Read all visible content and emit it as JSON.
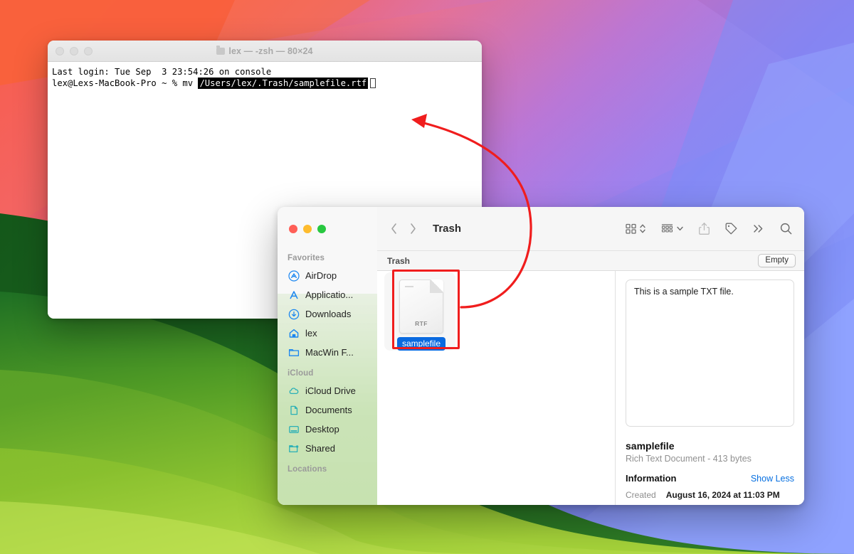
{
  "desktop": {
    "wallpaper_name": "macos-ventura-gradient",
    "colors": {
      "orange": "#f7603f",
      "red": "#f8514e",
      "pink": "#e0779f",
      "purple": "#9b6fe0",
      "blue": "#6f82f5",
      "light_blue": "#8ea0ff",
      "dark_green": "#1d6e26",
      "mid_green": "#63a72a",
      "bright_green": "#9ccd33"
    }
  },
  "terminal": {
    "title": "lex — -zsh — 80×24",
    "title_icon": "folder-icon",
    "traffic_lights": [
      "close",
      "minimize",
      "zoom"
    ],
    "lines": [
      {
        "text": "Last login: Tue Sep  3 23:54:26 on console"
      }
    ],
    "prompt": "lex@Lexs-MacBook-Pro ~ % mv ",
    "selected_argument": "/Users/lex/.Trash/samplefile.rtf",
    "cursor": "block-cursor"
  },
  "finder": {
    "title": "Trash",
    "traffic_lights": [
      "close",
      "minimize",
      "zoom"
    ],
    "nav": {
      "back": "chevron-left-icon",
      "forward": "chevron-right-icon"
    },
    "toolbar": [
      {
        "name": "view-grid-button",
        "icon": "grid-view-icon",
        "has_chevron": true,
        "chevron": "chevron-up-down-icon"
      },
      {
        "name": "group-by-button",
        "icon": "group-list-icon",
        "has_chevron": true,
        "chevron": "chevron-down-icon"
      },
      {
        "name": "share-button",
        "icon": "share-icon",
        "disabled": true
      },
      {
        "name": "tags-button",
        "icon": "tag-icon",
        "disabled": false
      },
      {
        "name": "more-button",
        "icon": "chevrons-right-icon",
        "disabled": false
      },
      {
        "name": "search-button",
        "icon": "search-icon",
        "disabled": false
      }
    ],
    "subbar": {
      "label": "Trash",
      "empty_button": "Empty"
    },
    "sidebar": {
      "sections": [
        {
          "header": "Favorites",
          "items": [
            {
              "label": "AirDrop",
              "icon": "airdrop-icon",
              "color": "#1a86f0"
            },
            {
              "label": "Applicatio...",
              "icon": "applications-icon",
              "color": "#1a86f0"
            },
            {
              "label": "Downloads",
              "icon": "downloads-icon",
              "color": "#1a86f0"
            },
            {
              "label": "lex",
              "icon": "home-icon",
              "color": "#1a86f0"
            },
            {
              "label": "MacWin F...",
              "icon": "folder-icon",
              "color": "#1a86f0"
            }
          ]
        },
        {
          "header": "iCloud",
          "items": [
            {
              "label": "iCloud Drive",
              "icon": "cloud-icon",
              "color": "#2bb0b6"
            },
            {
              "label": "Documents",
              "icon": "document-icon",
              "color": "#2bb0b6"
            },
            {
              "label": "Desktop",
              "icon": "desktop-icon",
              "color": "#2bb0b6"
            },
            {
              "label": "Shared",
              "icon": "shared-folder-icon",
              "color": "#2bb0b6"
            }
          ]
        },
        {
          "header": "Locations",
          "items": []
        }
      ]
    },
    "files": [
      {
        "name": "samplefile",
        "extension_badge": "RTF",
        "icon": "rtf-document-icon",
        "selected": true
      }
    ],
    "preview": {
      "body_text": "This is a sample TXT file.",
      "name": "samplefile",
      "kind_and_size": "Rich Text Document - 413 bytes",
      "information_title": "Information",
      "information_toggle": "Show Less",
      "metadata": [
        {
          "key": "Created",
          "value": "August 16, 2024 at 11:03 PM"
        }
      ]
    }
  },
  "annotations": {
    "highlight_color": "#f01d1d",
    "shapes": [
      {
        "type": "rectangle",
        "target": "samplefile-icon"
      },
      {
        "type": "curved-arrow",
        "from": "samplefile-icon",
        "to": "terminal-command-argument"
      }
    ]
  }
}
